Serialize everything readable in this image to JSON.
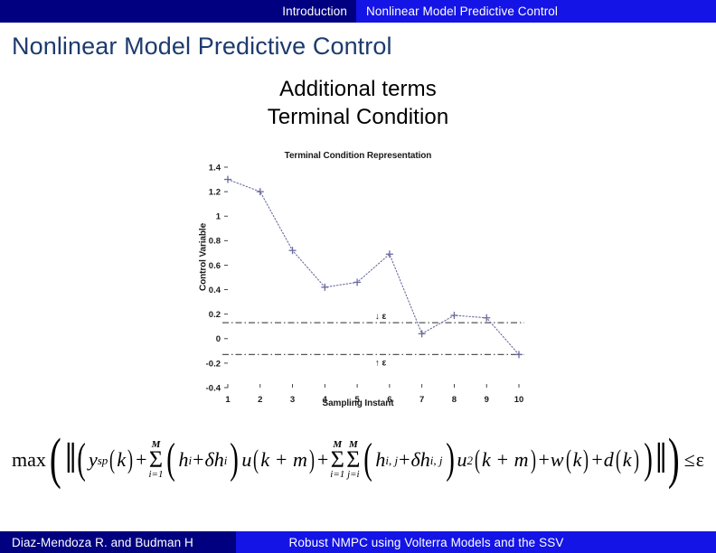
{
  "banner": {
    "left_label": "Introduction",
    "right_label": "Nonlinear Model Predictive Control",
    "navy": "#000080",
    "blue": "#1414e6"
  },
  "slide": {
    "title": "Nonlinear Model Predictive Control",
    "title_color": "#1d3b6e",
    "subtitle_line1": "Additional terms",
    "subtitle_line2": "Terminal Condition"
  },
  "chart_data": {
    "type": "line",
    "title": "Terminal Condition Representation",
    "xlabel": "Sampling Instant",
    "ylabel": "Control Variable",
    "x": [
      1,
      2,
      3,
      4,
      5,
      6,
      7,
      8,
      9,
      10
    ],
    "values": [
      1.3,
      1.2,
      0.72,
      0.42,
      0.46,
      0.69,
      0.04,
      0.19,
      0.17,
      -0.13
    ],
    "series": [
      {
        "name": "Control Variable",
        "values": [
          1.3,
          1.2,
          0.72,
          0.42,
          0.46,
          0.69,
          0.04,
          0.19,
          0.17,
          -0.13
        ]
      }
    ],
    "xtick_labels": [
      "1",
      "2",
      "3",
      "4",
      "5",
      "6",
      "7",
      "8",
      "9",
      "10"
    ],
    "ytick_labels": [
      "1.4",
      "1.2",
      "1",
      "0.8",
      "0.6",
      "0.4",
      "0.2",
      "0",
      "-0.2",
      "-0.4"
    ],
    "ytick_values": [
      1.4,
      1.2,
      1.0,
      0.8,
      0.6,
      0.4,
      0.2,
      0.0,
      -0.2,
      -0.4
    ],
    "xlim": [
      1,
      10
    ],
    "ylim": [
      -0.4,
      1.4
    ],
    "grid": false,
    "legend": "none",
    "marker": "plus",
    "line_style": "dotted",
    "series_color": "#6a6a9e",
    "bounds": {
      "upper_value": 0.13,
      "lower_value": -0.13,
      "style": "dash-dot",
      "color": "#555555",
      "upper_annotation": "↓ ε",
      "lower_annotation": "↑ ε"
    }
  },
  "equation": {
    "max_label": "max",
    "y_sp": "y",
    "y_sp_sup": "sp",
    "k_arg": "k",
    "plus": "+",
    "sigma_glyph": "Σ",
    "sum1_top": "M",
    "sum1_bottom": "i=1",
    "h_i": "h",
    "h_i_sub": "i",
    "delta_h_i": "δh",
    "delta_h_i_sub": "i",
    "u_var": "u",
    "k_plus_m": "k + m",
    "sum2_top": "M",
    "sum2_bottom": "i=1",
    "sum3_top": "M",
    "sum3_bottom": "j=i",
    "h_ij": "h",
    "h_ij_sub": "i, j",
    "delta_h_ij": "δh",
    "delta_h_ij_sub": "i, j",
    "u_sq": "u",
    "u_sq_sup": "2",
    "w_var": "w",
    "d_var": "d",
    "rel": "≤",
    "epsilon": "ε"
  },
  "footer": {
    "left_text": "Diaz-Mendoza R. and Budman H",
    "right_text": "Robust NMPC using Volterra Models and the SSV"
  }
}
